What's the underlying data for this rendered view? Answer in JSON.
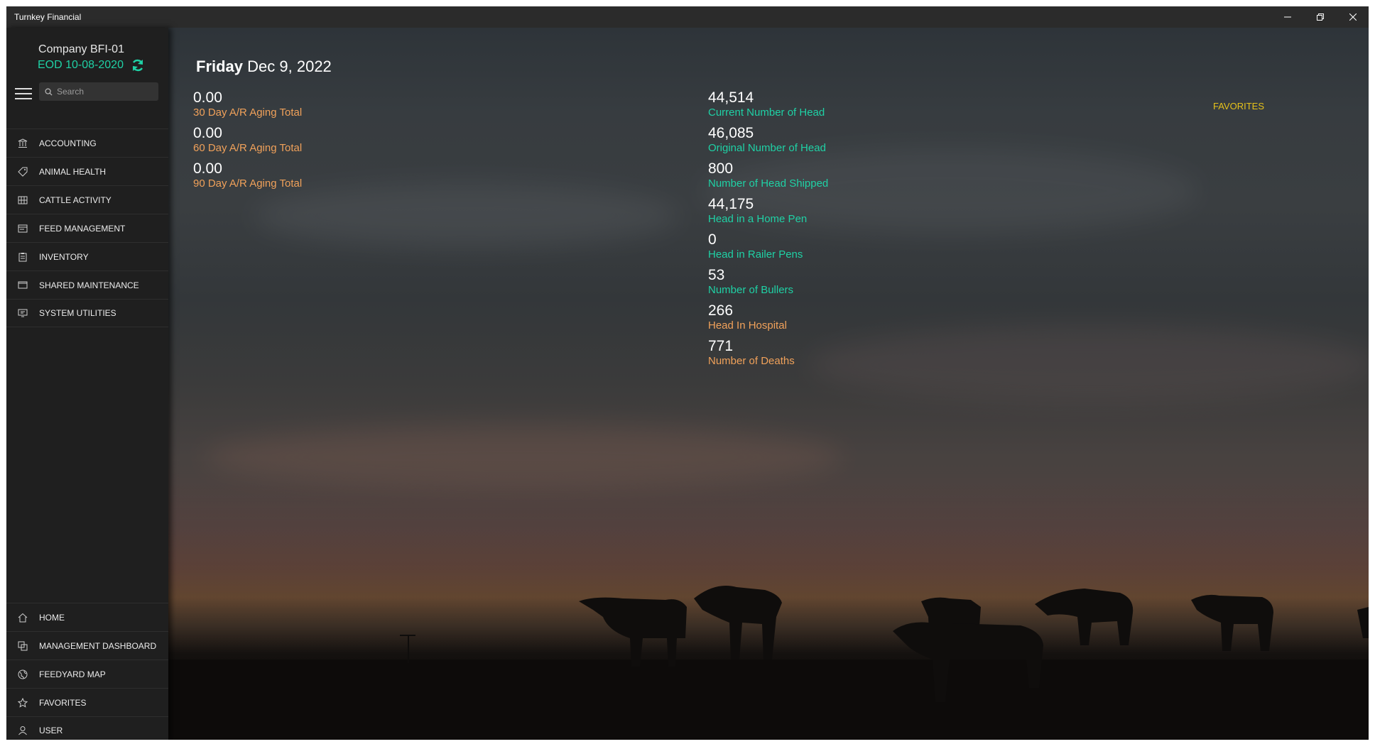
{
  "window": {
    "title": "Turnkey Financial"
  },
  "sidebar": {
    "company": "Company BFI-01",
    "eod": "EOD 10-08-2020",
    "search_placeholder": "Search",
    "nav_top": [
      {
        "label": "ACCOUNTING",
        "icon": "bank-icon"
      },
      {
        "label": "ANIMAL HEALTH",
        "icon": "tag-icon"
      },
      {
        "label": "CATTLE ACTIVITY",
        "icon": "grid-icon"
      },
      {
        "label": "FEED MANAGEMENT",
        "icon": "feed-icon"
      },
      {
        "label": "INVENTORY",
        "icon": "clipboard-icon"
      },
      {
        "label": "SHARED MAINTENANCE",
        "icon": "monitor-icon"
      },
      {
        "label": "SYSTEM UTILITIES",
        "icon": "utilities-icon"
      }
    ],
    "nav_bottom": [
      {
        "label": "HOME",
        "icon": "home-icon"
      },
      {
        "label": "MANAGEMENT DASHBOARD",
        "icon": "dashboard-icon"
      },
      {
        "label": "FEEDYARD MAP",
        "icon": "globe-icon"
      },
      {
        "label": "FAVORITES",
        "icon": "star-icon"
      },
      {
        "label": "USER",
        "icon": "user-icon"
      }
    ]
  },
  "main": {
    "day_name": "Friday",
    "date": "Dec 9, 2022",
    "favorites_label": "FAVORITES",
    "aging": [
      {
        "value": "0.00",
        "label": "30 Day A/R Aging Total"
      },
      {
        "value": "0.00",
        "label": "60 Day A/R Aging Total"
      },
      {
        "value": "0.00",
        "label": "90 Day A/R Aging Total"
      }
    ],
    "head_stats": [
      {
        "value": "44,514",
        "label": "Current Number of Head",
        "color": "teal"
      },
      {
        "value": "46,085",
        "label": "Original Number of Head",
        "color": "teal"
      },
      {
        "value": "800",
        "label": "Number of Head Shipped",
        "color": "teal"
      },
      {
        "value": "44,175",
        "label": "Head in a Home Pen",
        "color": "teal"
      },
      {
        "value": "0",
        "label": "Head in Railer Pens",
        "color": "teal"
      },
      {
        "value": "53",
        "label": "Number of Bullers",
        "color": "teal"
      },
      {
        "value": "266",
        "label": "Head In Hospital",
        "color": "orange"
      },
      {
        "value": "771",
        "label": "Number of Deaths",
        "color": "orange"
      }
    ]
  },
  "colors": {
    "accent_teal": "#1fd1a5",
    "accent_orange": "#f0a15a",
    "favorites_yellow": "#e6c21a"
  }
}
